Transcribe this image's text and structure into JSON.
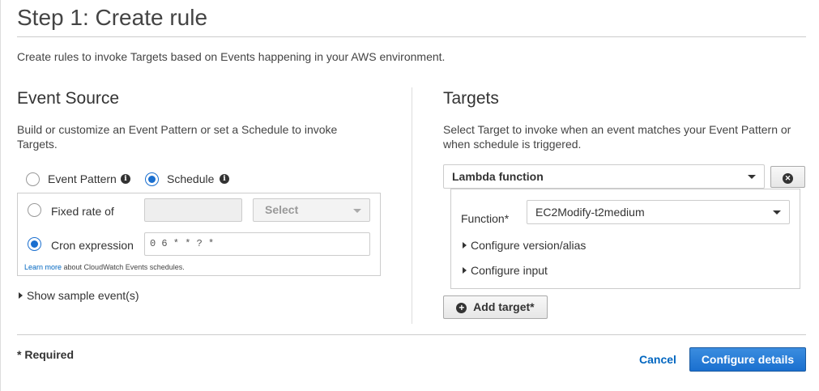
{
  "header": {
    "title": "Step 1: Create rule",
    "description": "Create rules to invoke Targets based on Events happening in your AWS environment."
  },
  "event_source": {
    "heading": "Event Source",
    "description": "Build or customize an Event Pattern or set a Schedule to invoke Targets.",
    "event_pattern_label": "Event Pattern",
    "schedule_label": "Schedule",
    "fixed_rate_label": "Fixed rate of",
    "fixed_rate_value": "",
    "fixed_rate_unit": "Select",
    "cron_label": "Cron expression",
    "cron_value": "0 6 * * ? *",
    "learn_more_link": "Learn more",
    "learn_more_text": " about CloudWatch Events schedules.",
    "show_sample": "Show sample event(s)"
  },
  "targets": {
    "heading": "Targets",
    "description": "Select Target to invoke when an event matches your Event Pattern or when schedule is triggered.",
    "target_type": "Lambda function",
    "function_label": "Function*",
    "function_value": "EC2Modify-t2medium",
    "configure_version": "Configure version/alias",
    "configure_input": "Configure input",
    "add_target": "Add target*",
    "remove_icon": "x-icon",
    "add_icon": "plus-icon"
  },
  "footer": {
    "required_note": "* Required",
    "cancel": "Cancel",
    "configure_details": "Configure details"
  }
}
